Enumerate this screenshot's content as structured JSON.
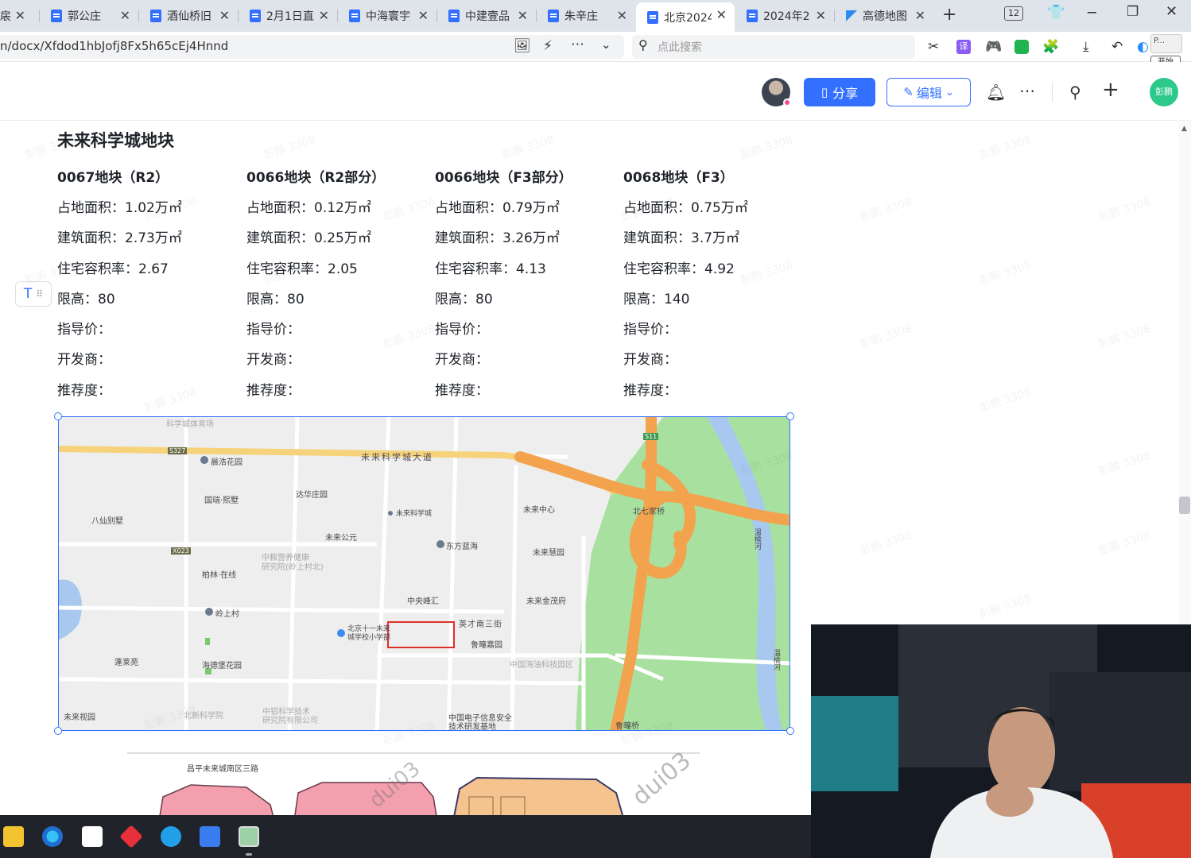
{
  "browser": {
    "tabs": [
      {
        "label": "扆",
        "icon": "doc-icon",
        "active": false
      },
      {
        "label": "郭公庄",
        "icon": "doc-icon",
        "active": false
      },
      {
        "label": "酒仙桥旧",
        "icon": "doc-icon",
        "active": false
      },
      {
        "label": "2月1日直",
        "icon": "doc-icon",
        "active": false
      },
      {
        "label": "中海寰宇",
        "icon": "doc-icon",
        "active": false
      },
      {
        "label": "中建壹品",
        "icon": "doc-icon",
        "active": false
      },
      {
        "label": "朱辛庄",
        "icon": "doc-icon",
        "active": false
      },
      {
        "label": "北京2024",
        "icon": "doc-icon",
        "active": true
      },
      {
        "label": "2024年2",
        "icon": "doc-icon",
        "active": false
      },
      {
        "label": "高德地图",
        "icon": "map-icon",
        "active": false
      }
    ],
    "tab_count": "12",
    "url": "n/docx/Xfdod1hbJofj8Fx5h65cEj4Hnnd",
    "search_placeholder": "点此搜索",
    "start_label": "开始",
    "ext_label": "P..."
  },
  "doc_header": {
    "share_label": "分享",
    "edit_label": "编辑",
    "user_badge": "彭鹏"
  },
  "document": {
    "section_title": "未来科学城地块",
    "parcels": [
      {
        "title": "0067地块（R2）",
        "land_area": "占地面积：1.02万㎡",
        "building_area": "建筑面积：2.73万㎡",
        "far": "住宅容积率：2.67",
        "height_limit": "限高：80",
        "guide_price": "指导价：",
        "developer": "开发商：",
        "recommendation": "推荐度："
      },
      {
        "title": "0066地块（R2部分）",
        "land_area": "占地面积：0.12万㎡",
        "building_area": "建筑面积：0.25万㎡",
        "far": "住宅容积率：2.05",
        "height_limit": "限高：80",
        "guide_price": "指导价：",
        "developer": "开发商：",
        "recommendation": "推荐度："
      },
      {
        "title": "0066地块（F3部分）",
        "land_area": "占地面积：0.79万㎡",
        "building_area": "建筑面积：3.26万㎡",
        "far": "住宅容积率：4.13",
        "height_limit": "限高：80",
        "guide_price": "指导价：",
        "developer": "开发商：",
        "recommendation": "推荐度："
      },
      {
        "title": "0068地块（F3）",
        "land_area": "占地面积：0.75万㎡",
        "building_area": "建筑面积：3.7万㎡",
        "far": "住宅容积率：4.92",
        "height_limit": "限高：140",
        "guide_price": "指导价：",
        "developer": "开发商：",
        "recommendation": "推荐度："
      }
    ],
    "block_handle_icon": "T",
    "watermark": "彭鹏 3308"
  },
  "map": {
    "road_main": "未来科学城大道",
    "labels": {
      "sports": "科学城体育场",
      "chenhao": "晨浩花园",
      "bxbs": "八仙别墅",
      "guoxi": "国瑞·熙墅",
      "dahua": "达华庄园",
      "wlkxc": "未来科学城",
      "wlzx": "未来中心",
      "bqjq": "北七家桥",
      "wlgy": "未来公元",
      "zhongliang": "中粮营养健康\n研究院(岭上村北)",
      "dflh": "东方蓝海",
      "wlhy": "未来慧园",
      "bolin": "柏林·在线",
      "zyfh": "中央峰汇",
      "wljm": "未来金茂府",
      "lingshang": "岭上村",
      "school": "北京十一未来\n城学校小学部",
      "yingcai": "英才南三街",
      "luhuang": "鲁疃嘉园",
      "haide": "海德堡花园",
      "penglai": "蓬莱苑",
      "cnooc": "中国海油科技园区",
      "wlsy": "未来视园",
      "bjkxy": "北新科学院",
      "cnmtec": "中铝科学技术\n研究院有限公司",
      "cnelec": "中国电子信息安全\n技术研发基地",
      "luqiao": "鲁疃桥",
      "wenyu1": "温榆河",
      "wenyu2": "温榆河",
      "s11": "S11",
      "s327": "S327",
      "x023": "X023"
    }
  },
  "plan": {
    "road_label": "昌平未来城南区三路",
    "watermark1": "dui03",
    "watermark2": "dui03"
  }
}
